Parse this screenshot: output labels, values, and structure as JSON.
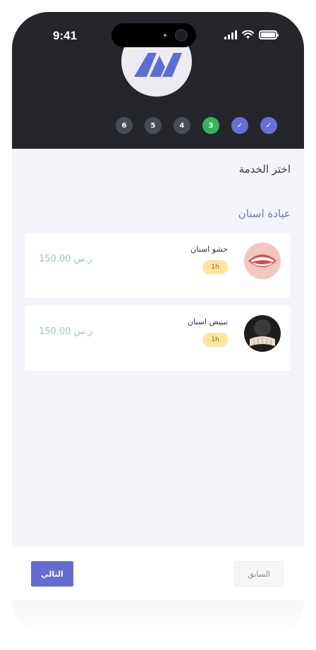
{
  "status_bar": {
    "time": "9:41"
  },
  "steps": [
    {
      "label": "6",
      "state": "pending"
    },
    {
      "label": "5",
      "state": "pending"
    },
    {
      "label": "4",
      "state": "pending"
    },
    {
      "label": "3",
      "state": "active"
    },
    {
      "label": "✓",
      "state": "done"
    },
    {
      "label": "✓",
      "state": "done"
    }
  ],
  "page": {
    "title": "اختر الخدمة",
    "category": "عيادة اسنان"
  },
  "services": [
    {
      "name": "حشو اسنان",
      "duration": "1h",
      "price": "150.00 ر.س",
      "image": "teeth-smile-image"
    },
    {
      "name": "تبييض اسنان",
      "duration": "1h",
      "price": "150.00 ر.س",
      "image": "teeth-dark-image"
    }
  ],
  "footer": {
    "next_label": "التالي",
    "prev_label": "السابق"
  },
  "colors": {
    "header_bg": "#25262b",
    "accent": "#646cd4",
    "step_active": "#2fb55f",
    "price": "#8bd8a3",
    "duration_badge": "#fde59c"
  }
}
